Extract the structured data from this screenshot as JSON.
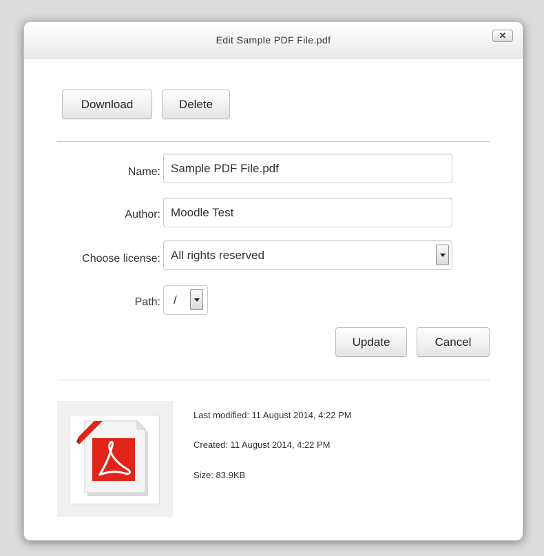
{
  "dialog": {
    "title": "Edit Sample PDF File.pdf",
    "close_symbol": "✕",
    "close_icon": "close-icon"
  },
  "actions": {
    "download_label": "Download",
    "delete_label": "Delete"
  },
  "form": {
    "name_label": "Name:",
    "name_value": "Sample PDF File.pdf",
    "author_label": "Author:",
    "author_value": "Moodle Test",
    "license_label": "Choose license:",
    "license_value": "All rights reserved",
    "path_label": "Path:",
    "path_value": "/",
    "update_label": "Update",
    "cancel_label": "Cancel"
  },
  "file_info": {
    "thumbnail_icon": "pdf-file-icon",
    "last_modified": "Last modified: 11 August 2014, 4:22 PM",
    "created": "Created: 11 August 2014, 4:22 PM",
    "size": "Size: 83.9KB"
  },
  "colors": {
    "pdf_red": "#e1251b",
    "accent_gray": "#c8c8c8"
  }
}
